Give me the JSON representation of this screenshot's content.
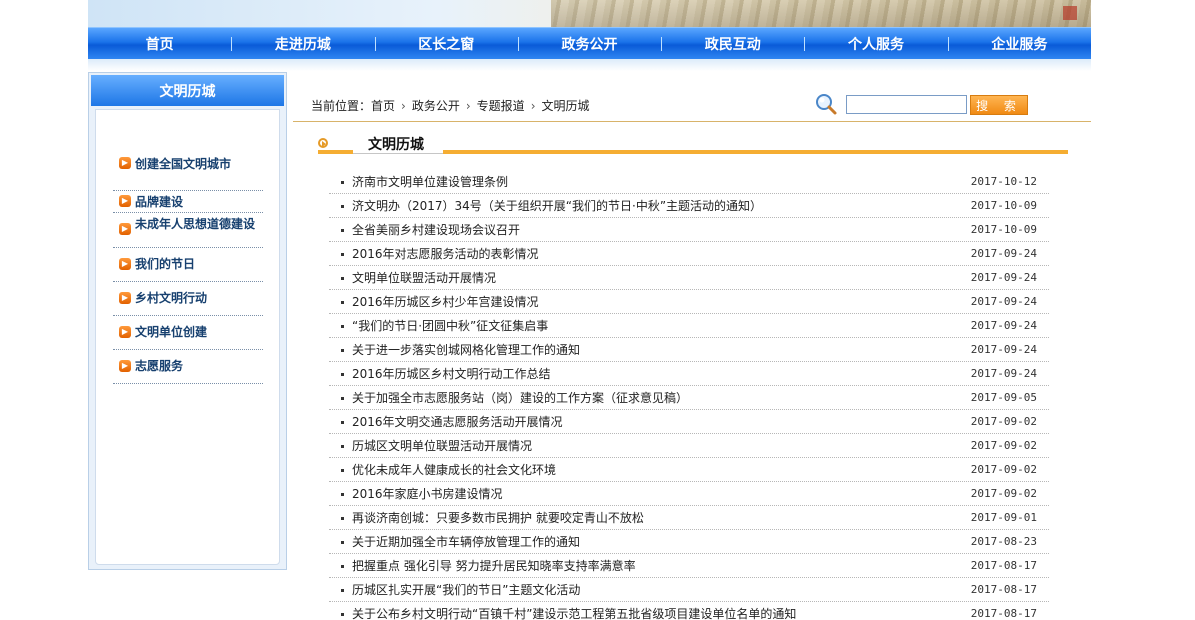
{
  "nav": {
    "items": [
      "首页",
      "走进历城",
      "区长之窗",
      "政务公开",
      "政民互动",
      "个人服务",
      "企业服务"
    ]
  },
  "sidebar": {
    "title": "文明历城",
    "items": [
      {
        "label": "创建全国文明城市"
      },
      {
        "label": "品牌建设"
      },
      {
        "label": "未成年人思想道德建设"
      },
      {
        "label": "我们的节日"
      },
      {
        "label": "乡村文明行动"
      },
      {
        "label": "文明单位创建"
      },
      {
        "label": "志愿服务"
      }
    ]
  },
  "breadcrumb": {
    "prefix": "当前位置：",
    "items": [
      "首页",
      "政务公开",
      "专题报道",
      "文明历城"
    ]
  },
  "search": {
    "placeholder": "",
    "button_label": "搜 索"
  },
  "section": {
    "title": "文明历城"
  },
  "articles": [
    {
      "title": "济南市文明单位建设管理条例",
      "date": "2017-10-12"
    },
    {
      "title": "济文明办（2017）34号（关于组织开展“我们的节日·中秋”主题活动的通知）",
      "date": "2017-10-09"
    },
    {
      "title": "全省美丽乡村建设现场会议召开",
      "date": "2017-10-09"
    },
    {
      "title": "2016年对志愿服务活动的表彰情况",
      "date": "2017-09-24"
    },
    {
      "title": "文明单位联盟活动开展情况",
      "date": "2017-09-24"
    },
    {
      "title": "2016年历城区乡村少年宫建设情况",
      "date": "2017-09-24"
    },
    {
      "title": "“我们的节日·团圆中秋”征文征集启事",
      "date": "2017-09-24"
    },
    {
      "title": "关于进一步落实创城网格化管理工作的通知",
      "date": "2017-09-24"
    },
    {
      "title": "2016年历城区乡村文明行动工作总结",
      "date": "2017-09-24"
    },
    {
      "title": "关于加强全市志愿服务站（岗）建设的工作方案（征求意见稿）",
      "date": "2017-09-05"
    },
    {
      "title": "2016年文明交通志愿服务活动开展情况",
      "date": "2017-09-02"
    },
    {
      "title": "历城区文明单位联盟活动开展情况",
      "date": "2017-09-02"
    },
    {
      "title": "优化未成年人健康成长的社会文化环境",
      "date": "2017-09-02"
    },
    {
      "title": "2016年家庭小书房建设情况",
      "date": "2017-09-02"
    },
    {
      "title": "再谈济南创城：只要多数市民拥护 就要咬定青山不放松",
      "date": "2017-09-01"
    },
    {
      "title": "关于近期加强全市车辆停放管理工作的通知",
      "date": "2017-08-23"
    },
    {
      "title": "把握重点 强化引导 努力提升居民知晓率支持率满意率",
      "date": "2017-08-17"
    },
    {
      "title": "历城区扎实开展“我们的节日”主题文化活动",
      "date": "2017-08-17"
    },
    {
      "title": "关于公布乡村文明行动“百镇千村”建设示范工程第五批省级项目建设单位名单的通知",
      "date": "2017-08-17"
    }
  ]
}
